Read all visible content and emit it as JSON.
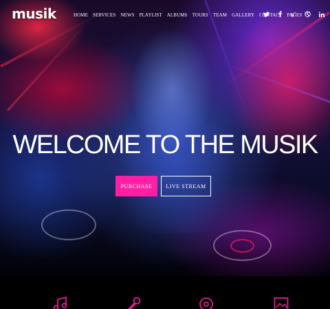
{
  "brand": {
    "logo_text": "musik"
  },
  "nav": {
    "items": [
      "HOME",
      "SERVICES",
      "NEWS",
      "PLAYLIST",
      "ALBUMS",
      "TOURS",
      "TEAM",
      "GALLERY",
      "CONTACT",
      "PAGES"
    ]
  },
  "social": {
    "icons": [
      "twitter-icon",
      "facebook-icon",
      "google-plus-icon",
      "dribbble-icon",
      "linkedin-icon"
    ]
  },
  "hero": {
    "headline": "WELCOME TO THE MUSIK",
    "purchase_label": "PURCHASE",
    "live_stream_label": "LIVE STREAM"
  },
  "features": {
    "icons": [
      "music-note-icon",
      "microphone-icon",
      "vinyl-disc-icon",
      "picture-icon"
    ]
  },
  "colors": {
    "accent": "#ff1fa5",
    "text": "#ffffff",
    "background": "#000000"
  }
}
